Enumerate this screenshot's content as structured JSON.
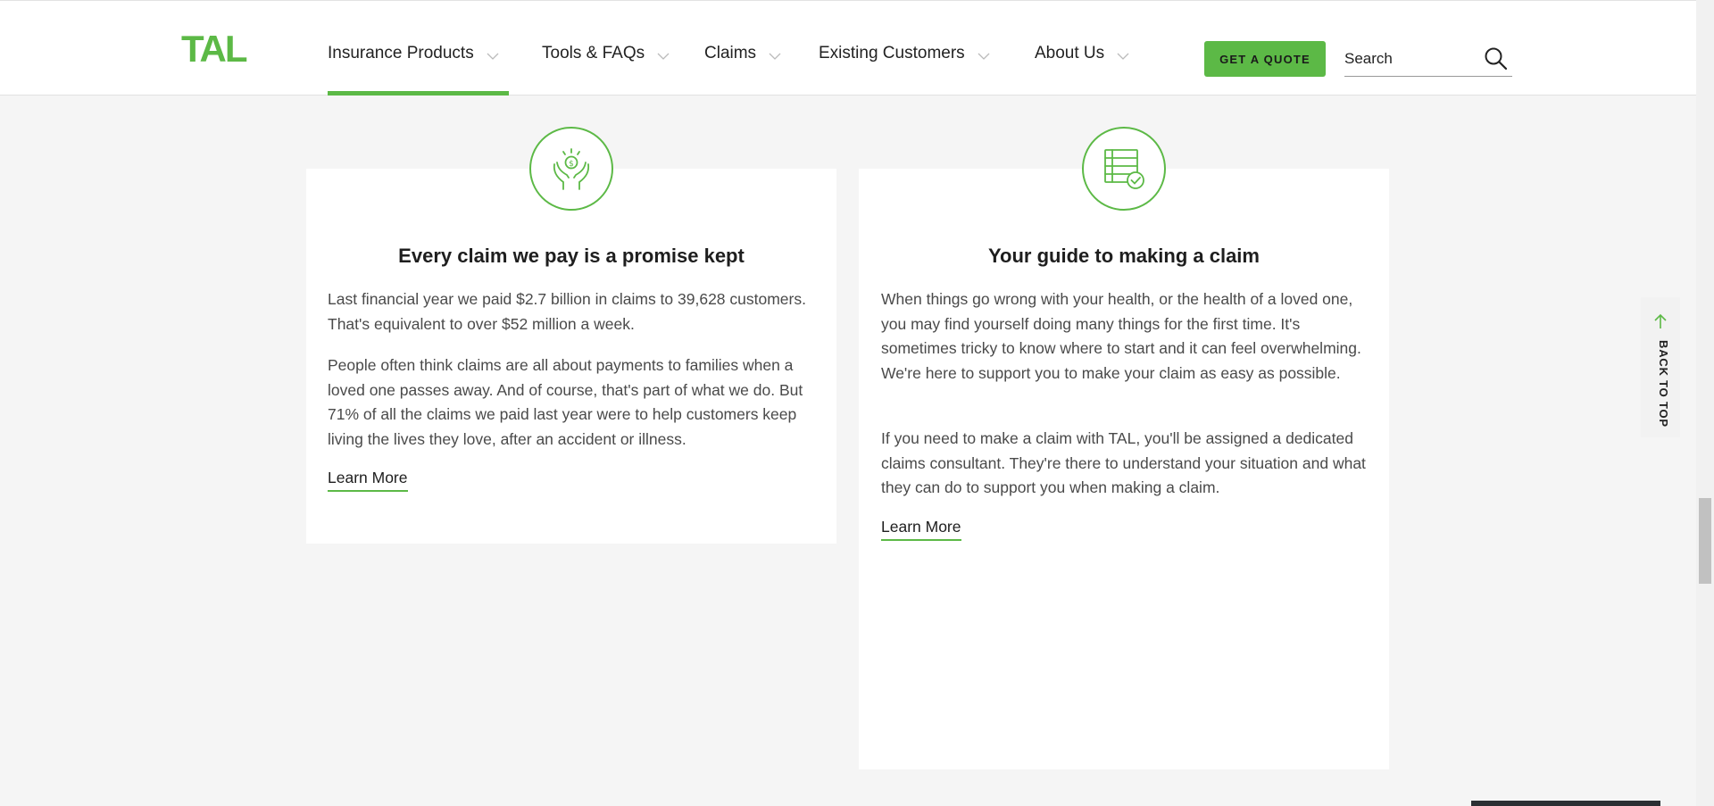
{
  "header": {
    "logo": "TAL",
    "nav": [
      {
        "label": "Insurance Products",
        "active": true
      },
      {
        "label": "Tools & FAQs",
        "active": false
      },
      {
        "label": "Claims",
        "active": false
      },
      {
        "label": "Existing Customers",
        "active": false
      },
      {
        "label": "About Us",
        "active": false
      }
    ],
    "quote_label": "GET A QUOTE",
    "search_placeholder": "Search"
  },
  "cards": [
    {
      "icon": "hands-money-icon",
      "title": "Every claim we pay is a promise kept",
      "paragraphs": [
        "Last financial year we paid $2.7 billion in claims to 39,628 customers. That's equivalent to over $52 million a week.",
        "People often think claims are all about payments to families when a loved one passes away. And of course, that's part of what we do. But 71% of all the claims we paid last year were to help customers keep living the lives they love, after an accident or illness."
      ],
      "link": "Learn More"
    },
    {
      "icon": "checklist-icon",
      "title": "Your guide to making a claim",
      "paragraphs": [
        "When things go wrong with your health, or the health of a loved one, you may find yourself doing many things for the first time. It's sometimes tricky to know where to start and it can feel overwhelming. We're here to support you to make your claim as easy as possible.",
        "If you need to make a claim with TAL, you'll be assigned a dedicated claims consultant. They're there to understand your situation and what they can do to support you when making a claim."
      ],
      "link": "Learn More"
    }
  ],
  "back_to_top": "BACK TO TOP",
  "colors": {
    "accent": "#5cb946",
    "background": "#f5f5f5"
  }
}
